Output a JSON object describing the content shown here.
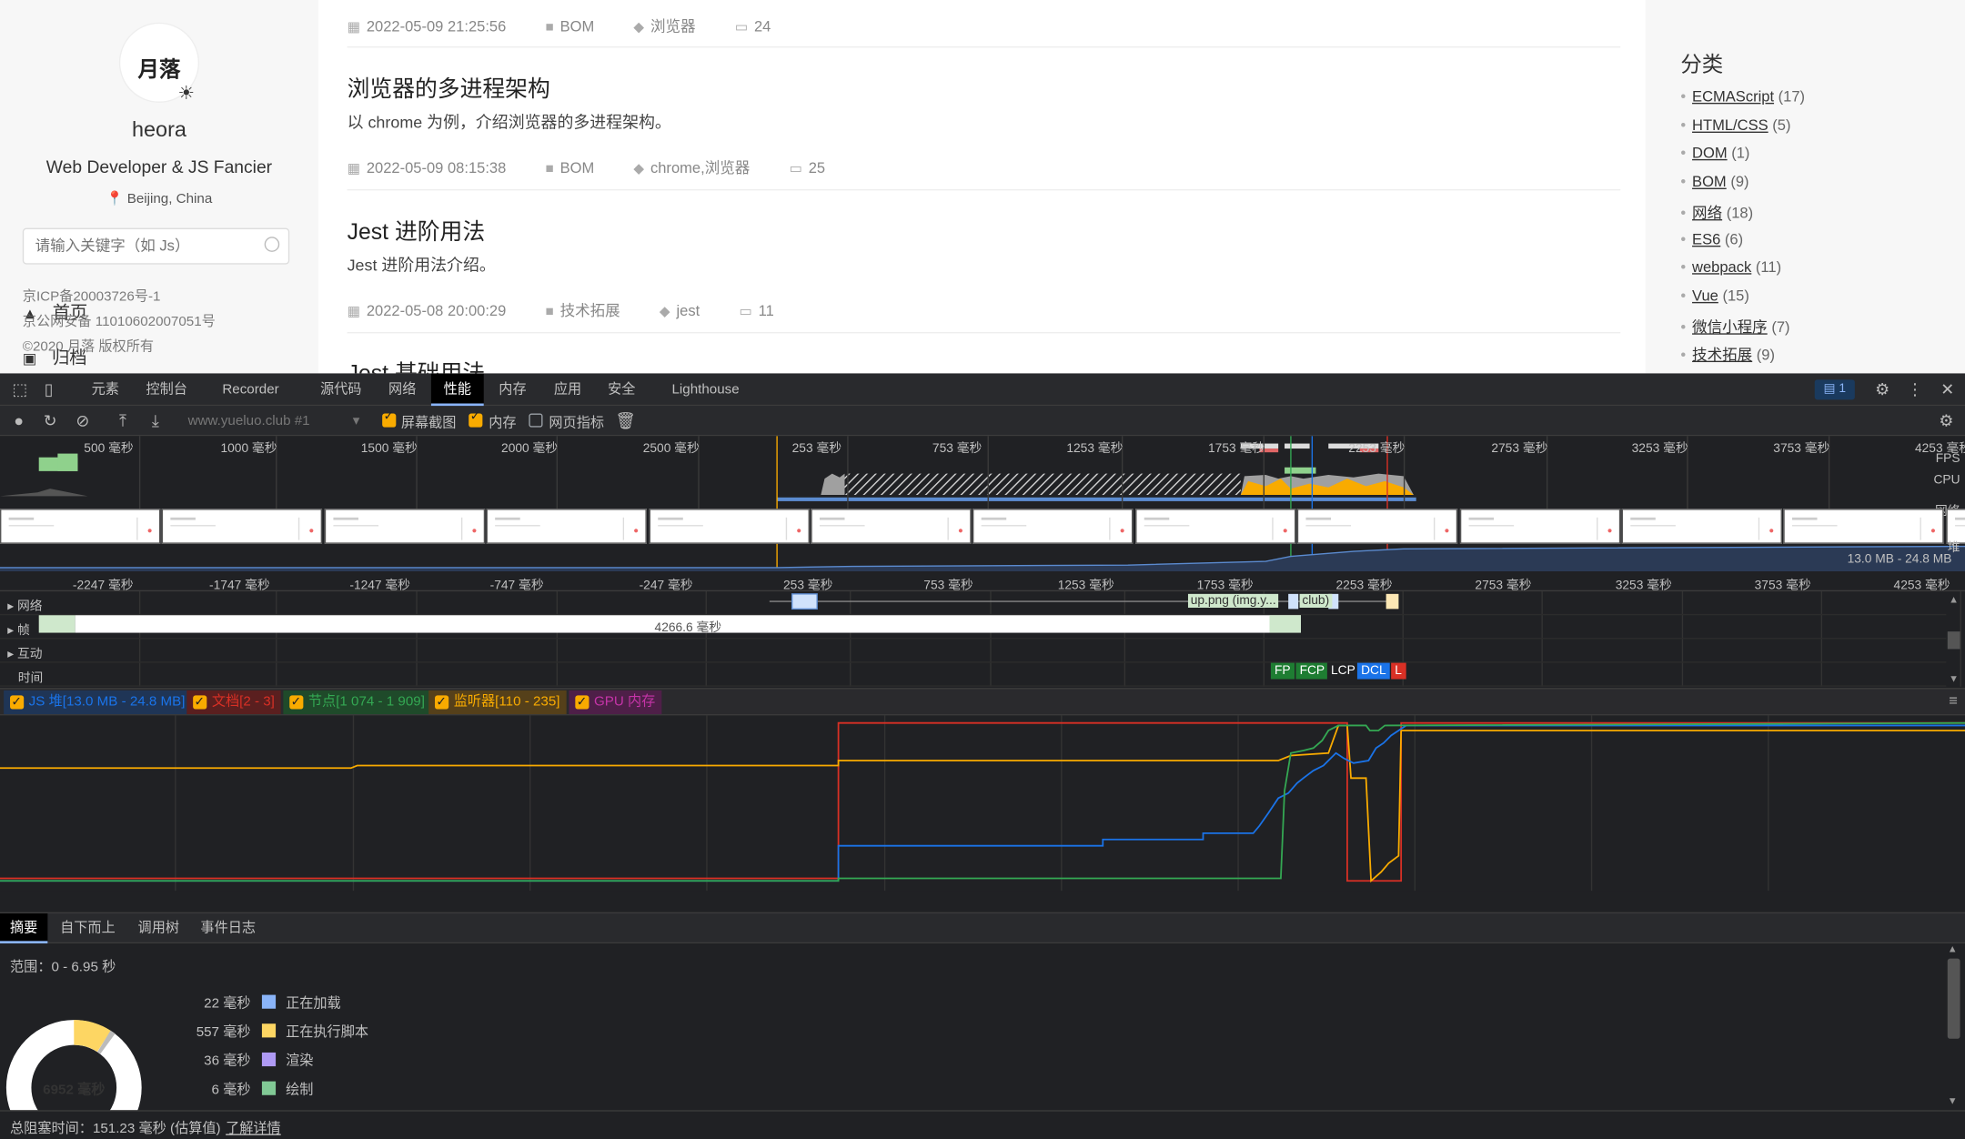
{
  "site": {
    "logo_text": "月落",
    "author": "heora",
    "tagline": "Web Developer & JS Fancier",
    "location": "Beijing, China",
    "search_placeholder": "请输入关键字（如 Js）",
    "nav": [
      {
        "label": "首页",
        "icon": "home-icon"
      },
      {
        "label": "归档",
        "icon": "archive-icon"
      }
    ],
    "icp": [
      "京ICP备20003726号-1",
      "京公网安备 11010602007051号",
      "©2020 月落 版权所有"
    ],
    "posts": [
      {
        "date": "2022-05-09 21:25:56",
        "category": "BOM",
        "tags": "浏览器",
        "comments": "24"
      },
      {
        "title": "浏览器的多进程架构",
        "desc": "以 chrome 为例，介绍浏览器的多进程架构。",
        "date": "2022-05-09 08:15:38",
        "category": "BOM",
        "tags": "chrome,浏览器",
        "comments": "25"
      },
      {
        "title": "Jest 进阶用法",
        "desc": "Jest 进阶用法介绍。",
        "date": "2022-05-08 20:00:29",
        "category": "技术拓展",
        "tags": "jest",
        "comments": "11"
      },
      {
        "title": "Jest 基础用法"
      }
    ],
    "categories_title": "分类",
    "categories": [
      {
        "name": "ECMAScript",
        "count": "(17)"
      },
      {
        "name": "HTML/CSS",
        "count": "(5)"
      },
      {
        "name": "DOM",
        "count": "(1)"
      },
      {
        "name": "BOM",
        "count": "(9)"
      },
      {
        "name": "网络",
        "count": "(18)"
      },
      {
        "name": "ES6",
        "count": "(6)"
      },
      {
        "name": "webpack",
        "count": "(11)"
      },
      {
        "name": "Vue",
        "count": "(15)"
      },
      {
        "name": "微信小程序",
        "count": "(7)"
      },
      {
        "name": "技术拓展",
        "count": "(9)"
      }
    ]
  },
  "devtools": {
    "tabs": [
      "元素",
      "控制台",
      "Recorder",
      "源代码",
      "网络",
      "性能",
      "内存",
      "应用",
      "安全",
      "Lighthouse"
    ],
    "active_tab": "性能",
    "messages_count": "1",
    "url": "www.yueluo.club #1",
    "options": [
      {
        "label": "屏幕截图",
        "checked": true
      },
      {
        "label": "内存",
        "checked": true
      },
      {
        "label": "网页指标",
        "checked": false
      }
    ],
    "overview_ticks": [
      "500 毫秒",
      "1000 毫秒",
      "1500 毫秒",
      "2000 毫秒",
      "2500 毫秒",
      "253 毫秒",
      "753 毫秒",
      "1253 毫秒",
      "1753 毫秒",
      "2253 毫秒",
      "2753 毫秒",
      "3253 毫秒",
      "3753 毫秒",
      "4253 毫秒"
    ],
    "overview_labels": {
      "fps": "FPS",
      "cpu": "CPU",
      "net": "网络",
      "heap": "堆"
    },
    "heap_range": "13.0 MB - 24.8 MB",
    "timeline_ticks": [
      "-2247 毫秒",
      "-1747 毫秒",
      "-1247 毫秒",
      "-747 毫秒",
      "-247 毫秒",
      "253 毫秒",
      "753 毫秒",
      "1253 毫秒",
      "1753 毫秒",
      "2253 毫秒",
      "2753 毫秒",
      "3253 毫秒",
      "3753 毫秒",
      "4253 毫秒"
    ],
    "tracks": [
      "网络",
      "帧",
      "互动",
      "时间"
    ],
    "frame_duration": "4266.6 毫秒",
    "network_requests": [
      "up.png (img.y...",
      "club)"
    ],
    "markers": [
      {
        "label": "FP",
        "color": "#1e7d32"
      },
      {
        "label": "FCP",
        "color": "#1e7d32"
      },
      {
        "label": "LCP",
        "color": "#202124"
      },
      {
        "label": "DCL",
        "color": "#1a73e8"
      },
      {
        "label": "L",
        "color": "#d93025"
      }
    ],
    "counters": [
      {
        "label": "JS 堆[13.0 MB - 24.8 MB]",
        "color": "#1a73e8",
        "bg": "#1f3556"
      },
      {
        "label": "文档[2 - 3]",
        "color": "#d93025",
        "bg": "#5a1f1f"
      },
      {
        "label": "节点[1 074 - 1 909]",
        "color": "#34a853",
        "bg": "#1f4a2a"
      },
      {
        "label": "监听器[110 - 235]",
        "color": "#f9ab00",
        "bg": "#55401a"
      },
      {
        "label": "GPU 内存",
        "color": "#c534a8",
        "bg": "#4e1f48"
      }
    ],
    "bottom_tabs": [
      "摘要",
      "自下而上",
      "调用树",
      "事件日志"
    ],
    "range_text": "范围：0 - 6.95 秒",
    "summary": [
      {
        "value": "22 毫秒",
        "label": "正在加载",
        "color": "#8ab4f8"
      },
      {
        "value": "557 毫秒",
        "label": "正在执行脚本",
        "color": "#fdd663"
      },
      {
        "value": "36 毫秒",
        "label": "渲染",
        "color": "#af9af5"
      },
      {
        "value": "6 毫秒",
        "label": "绘制",
        "color": "#81c995"
      }
    ],
    "total": "6952 毫秒",
    "blocking_text": "总阻塞时间：151.23 毫秒 (估算值)",
    "learn_more": "了解详情"
  }
}
